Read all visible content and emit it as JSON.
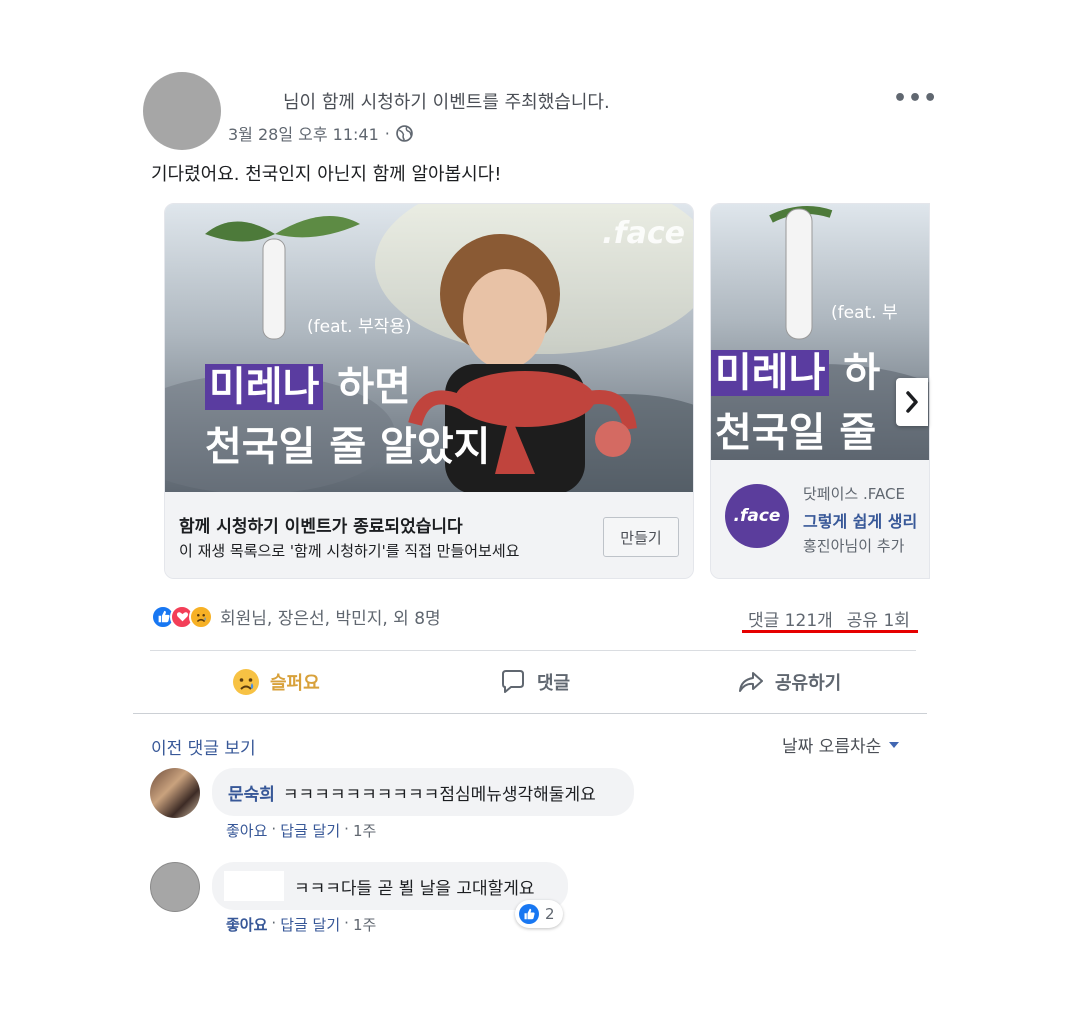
{
  "post": {
    "header_text": "님이 함께 시청하기 이벤트를 주최했습니다.",
    "timestamp": "3월 28일 오후 11:41",
    "separator": "·",
    "more_label": "•••",
    "text": "기다렸어요. 천국인지 아닌지 함께 알아봅시다!"
  },
  "carousel": {
    "card1": {
      "brand": ".face",
      "feat": "(feat. 부작용)",
      "headline_highlight": "미레나",
      "headline_rest": " 하면",
      "headline_line2": "천국일 줄 알았지",
      "title": "함께 시청하기 이벤트가 종료되었습니다",
      "subtitle": "이 재생 목록으로 '함께 시청하기'를 직접 만들어보세요",
      "button_label": "만들기"
    },
    "card2": {
      "feat": "(feat. 부",
      "headline_highlight": "미레나",
      "headline_rest": " 하",
      "headline_line2": "천국일 줄",
      "logo_text": ".face",
      "line1": "닷페이스 .FACE",
      "line2": "그렇게 쉽게 생리",
      "line3": "홍진아님이 추가"
    }
  },
  "reactions": {
    "people": "회원님, 장은선, 박민지, 외 8명",
    "comments_count": "댓글 121개",
    "shares_count": "공유 1회"
  },
  "actions": {
    "sad": "슬퍼요",
    "comment": "댓글",
    "share": "공유하기"
  },
  "comments_section": {
    "prev_label": "이전 댓글 보기",
    "sort_label": "날짜 오름차순"
  },
  "comments": [
    {
      "author": "문숙희",
      "text": "ㅋㅋㅋㅋㅋㅋㅋㅋㅋㅋ점심메뉴생각해둘게요",
      "like": "좋아요",
      "reply": "답글 달기",
      "time": "1주"
    },
    {
      "author": "",
      "text": "ㅋㅋㅋ다들 곧 뵐 날을 고대할게요",
      "like": "좋아요",
      "reply": "답글 달기",
      "time": "1주",
      "like_count": "2"
    }
  ],
  "colors": {
    "link": "#385898",
    "sad_reaction": "#d8a13b",
    "highlight_underline": "#e60000",
    "brand_purple": "#5b3d9c"
  }
}
